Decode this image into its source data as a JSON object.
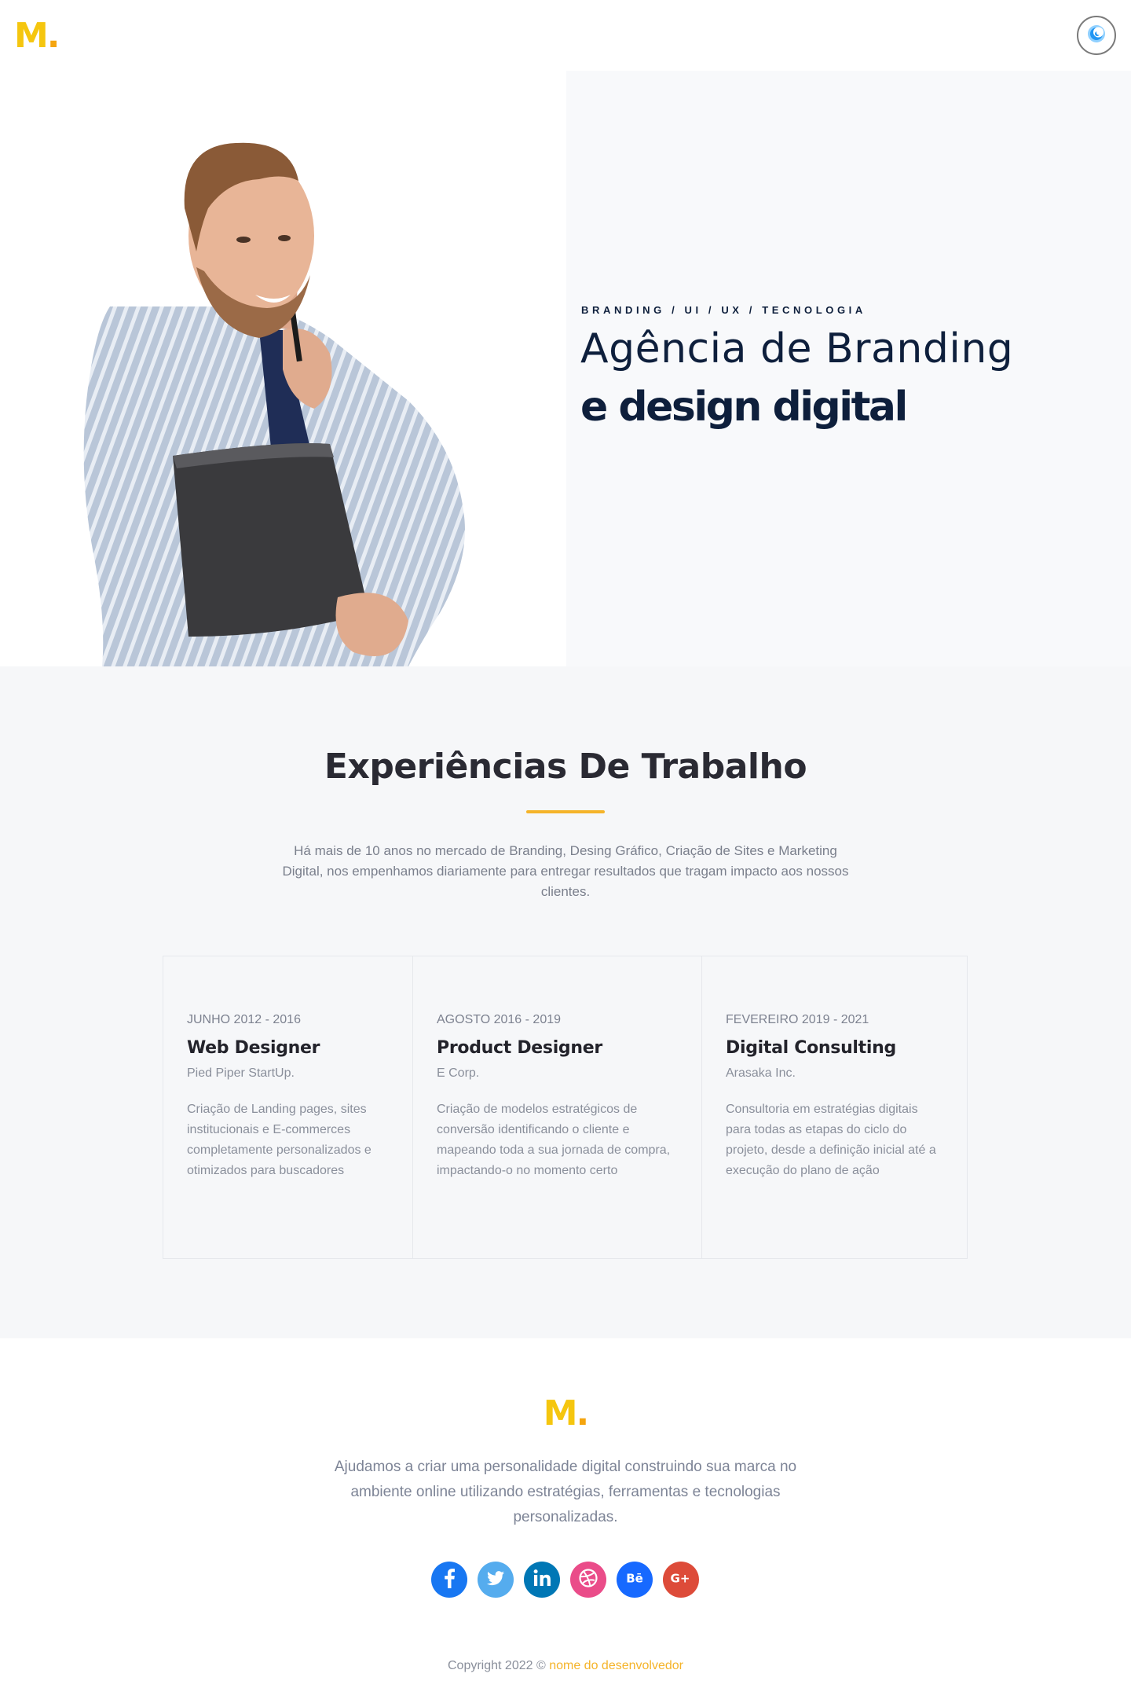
{
  "header": {
    "logo_letter": "M",
    "logo_dot": ".",
    "theme_toggle_icon": "moon-icon"
  },
  "hero": {
    "tags": "BRANDING / UI / UX / TECNOLOGIA",
    "title": "Agência de Branding",
    "subtitle": "e design digital",
    "image": "man-holding-folder-photo"
  },
  "experience": {
    "title": "Experiências De Trabalho",
    "description": "Há mais de 10 anos no mercado de Branding, Desing Gráfico, Criação de Sites e Marketing Digital, nos empenhamos diariamente para entregar resultados que tragam impacto aos nossos clientes.",
    "items": [
      {
        "date": "JUNHO 2012 - 2016",
        "title": "Web Designer",
        "company": "Pied Piper StartUp.",
        "text": "Criação de Landing pages, sites institucionais e E-commerces completamente personalizados e otimizados para buscadores"
      },
      {
        "date": "AGOSTO 2016 - 2019",
        "title": "Product Designer",
        "company": "E Corp.",
        "text": "Criação de modelos estratégicos de conversão identificando o cliente e mapeando toda a sua jornada de compra, impactando-o no momento certo"
      },
      {
        "date": "FEVEREIRO 2019 - 2021",
        "title": "Digital Consulting",
        "company": "Arasaka Inc.",
        "text": "Consultoria em estratégias digitais para todas as etapas do ciclo do projeto, desde a definição inicial até a execução do plano de ação"
      }
    ]
  },
  "footer": {
    "logo_letter": "M",
    "logo_dot": ".",
    "text": "Ajudamos a criar uma personalidade digital construindo sua marca no ambiente online utilizando estratégias, ferramentas e tecnologias personalizadas.",
    "socials": [
      {
        "name": "facebook-icon",
        "color": "#1877f2"
      },
      {
        "name": "twitter-icon",
        "color": "#55acee"
      },
      {
        "name": "linkedin-icon",
        "color": "#0077b5"
      },
      {
        "name": "dribbble-icon",
        "color": "#ea4c89"
      },
      {
        "name": "behance-icon",
        "color": "#1769ff"
      },
      {
        "name": "google-plus-icon",
        "color": "#dd4b39"
      }
    ],
    "copyright_prefix": "Copyright 2022 ©",
    "copyright_link": "nome do desenvolvedor"
  },
  "colors": {
    "accent_yellow": "#f5c60f",
    "accent_orange": "#f5b42a",
    "navy": "#0e1f3c",
    "section_bg": "#f6f7f9"
  }
}
